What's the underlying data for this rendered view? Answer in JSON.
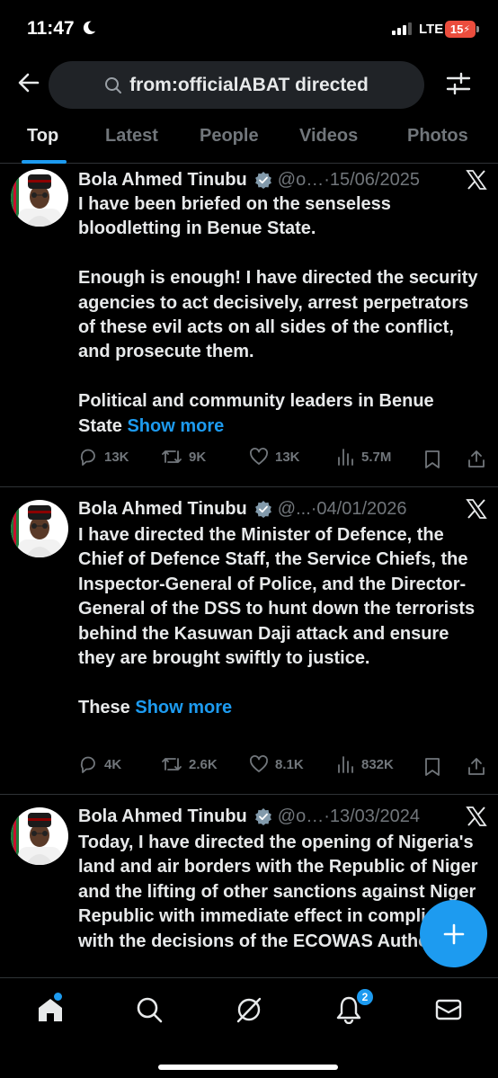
{
  "status_bar": {
    "time": "11:47",
    "network": "LTE",
    "battery": "15"
  },
  "search": {
    "query": "from:officialABAT directed"
  },
  "tabs": [
    {
      "label": "Top",
      "active": true
    },
    {
      "label": "Latest",
      "active": false
    },
    {
      "label": "People",
      "active": false
    },
    {
      "label": "Videos",
      "active": false
    },
    {
      "label": "Photos",
      "active": false
    }
  ],
  "tweets": [
    {
      "name": "Bola Ahmed Tinubu",
      "handle": "@o…",
      "date": "·15/06/2025",
      "paragraphs": [
        "I have been briefed on the senseless bloodletting in Benue State.",
        "Enough is enough! I have directed the security agencies to act decisively, arrest perpetrators of these evil acts on all sides of the conflict, and prosecute them.",
        "Political and community leaders in Benue State"
      ],
      "show_more": "Show more",
      "replies": "13K",
      "reposts": "9K",
      "likes": "13K",
      "views": "5.7M"
    },
    {
      "name": "Bola Ahmed Tinubu",
      "handle": "@...",
      "date": "·04/01/2026",
      "paragraphs": [
        "I have directed the Minister of Defence, the Chief of Defence Staff, the Service Chiefs, the Inspector-General of Police, and the Director-General of the DSS to hunt down the terrorists behind the Kasuwan Daji attack and ensure they are brought swiftly to justice.",
        "These"
      ],
      "show_more": "Show more",
      "replies": "4K",
      "reposts": "2.6K",
      "likes": "8.1K",
      "views": "832K"
    },
    {
      "name": "Bola Ahmed Tinubu",
      "handle": "@o…",
      "date": "·13/03/2024",
      "paragraphs": [
        "Today, I have directed the opening of Nigeria's land and air borders with the Republic of Niger and the lifting of other sanctions against Niger Republic with immediate effect in compliance with the decisions of the ECOWAS Authority of"
      ]
    }
  ],
  "bottom_nav": {
    "items": [
      "home-icon",
      "search-icon",
      "grok-icon",
      "notifications-icon",
      "messages-icon"
    ],
    "notification_count": "2"
  },
  "colors": {
    "accent": "#1d9bf0",
    "background": "#000000",
    "muted": "#71767b",
    "text": "#e7e9ea"
  }
}
